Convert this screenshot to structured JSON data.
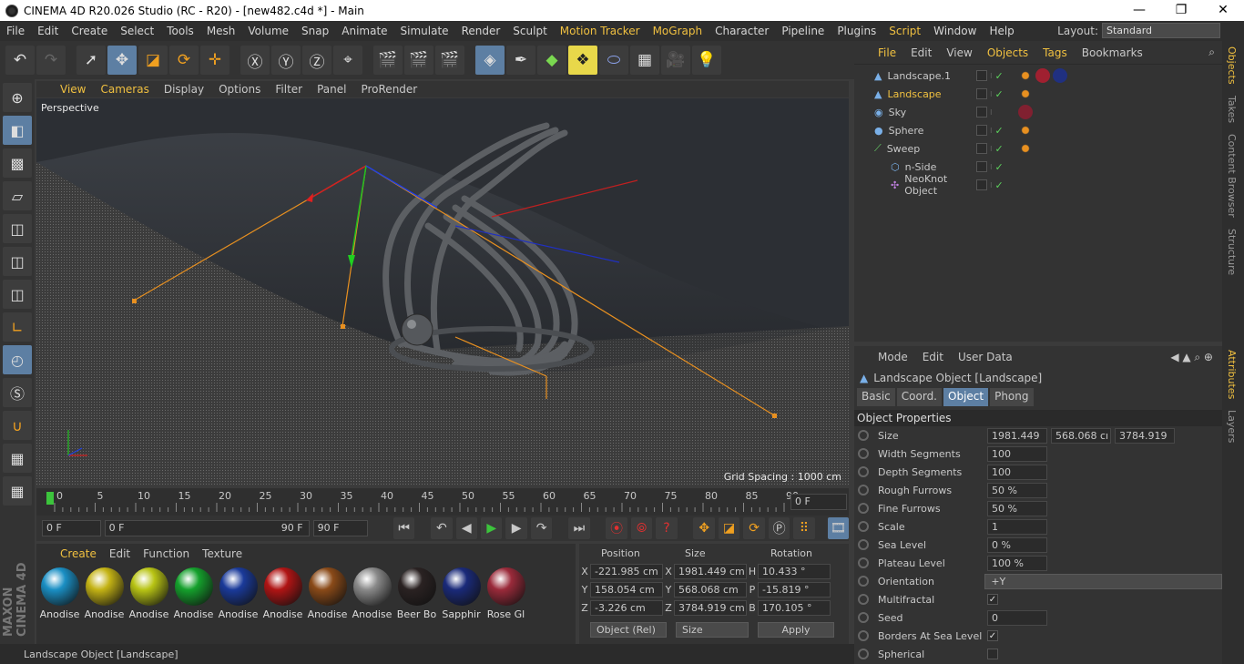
{
  "window": {
    "title": "CINEMA 4D R20.026 Studio (RC - R20) - [new482.c4d *] - Main",
    "minimize": "—",
    "maximize": "❐",
    "close": "✕"
  },
  "menubar": {
    "items": [
      "File",
      "Edit",
      "Create",
      "Select",
      "Tools",
      "Mesh",
      "Volume",
      "Snap",
      "Animate",
      "Simulate",
      "Render",
      "Sculpt",
      "Motion Tracker",
      "MoGraph",
      "Character",
      "Pipeline",
      "Plugins",
      "Script",
      "Window",
      "Help"
    ],
    "layout_label": "Layout:",
    "layout_value": "Standard"
  },
  "viewport": {
    "menu": [
      "View",
      "Cameras",
      "Display",
      "Options",
      "Filter",
      "Panel",
      "ProRender"
    ],
    "label": "Perspective",
    "grid_spacing": "Grid Spacing : 1000 cm"
  },
  "timeline": {
    "ticks": [
      "0",
      "5",
      "10",
      "15",
      "20",
      "25",
      "30",
      "35",
      "40",
      "45",
      "50",
      "55",
      "60",
      "65",
      "70",
      "75",
      "80",
      "85",
      "90"
    ],
    "current_frame": "0 F",
    "start": "0 F",
    "range_start": "0 F",
    "range_end": "90 F",
    "end": "90 F"
  },
  "materials": {
    "menu": [
      "Create",
      "Edit",
      "Function",
      "Texture"
    ],
    "items": [
      {
        "label": "Anodise",
        "color": "#1a8fc4"
      },
      {
        "label": "Anodise",
        "color": "#c4b314"
      },
      {
        "label": "Anodise",
        "color": "#b8c414"
      },
      {
        "label": "Anodise",
        "color": "#14a02c"
      },
      {
        "label": "Anodise",
        "color": "#1a3a9a"
      },
      {
        "label": "Anodise",
        "color": "#b01414"
      },
      {
        "label": "Anodise",
        "color": "#8a4a18"
      },
      {
        "label": "Anodise",
        "color": "#8a8a8a"
      },
      {
        "label": "Beer Bo",
        "color": "#2a2222"
      },
      {
        "label": "Sapphir",
        "color": "#1a2a7a"
      },
      {
        "label": "Rose Gl",
        "color": "#9a2a3a"
      }
    ]
  },
  "coords": {
    "headers": [
      "Position",
      "Size",
      "Rotation"
    ],
    "rows": [
      {
        "axis": "X",
        "pos": "-221.985 cm",
        "size_axis": "X",
        "size": "1981.449 cm",
        "rot_axis": "H",
        "rot": "10.433 °"
      },
      {
        "axis": "Y",
        "pos": "158.054 cm",
        "size_axis": "Y",
        "size": "568.068 cm",
        "rot_axis": "P",
        "rot": "-15.819 °"
      },
      {
        "axis": "Z",
        "pos": "-3.226 cm",
        "size_axis": "Z",
        "size": "3784.919 cm",
        "rot_axis": "B",
        "rot": "170.105 °"
      }
    ],
    "mode": "Object (Rel)",
    "size_mode": "Size",
    "apply": "Apply"
  },
  "status": "Landscape Object [Landscape]",
  "objects": {
    "menu": [
      "File",
      "Edit",
      "View",
      "Objects",
      "Tags",
      "Bookmarks"
    ],
    "rows": [
      {
        "name": "Landscape.1",
        "icon": "landscape-icon"
      },
      {
        "name": "Landscape",
        "icon": "landscape-icon"
      },
      {
        "name": "Sky",
        "icon": "sky-icon"
      },
      {
        "name": "Sphere",
        "icon": "sphere-icon"
      },
      {
        "name": "Sweep",
        "icon": "sweep-icon"
      },
      {
        "name": "n-Side",
        "icon": "nside-icon"
      },
      {
        "name": "NeoKnot Object",
        "icon": "knot-icon"
      }
    ]
  },
  "attributes": {
    "menu": [
      "Mode",
      "Edit",
      "User Data"
    ],
    "title": "Landscape Object [Landscape]",
    "tabs": [
      "Basic",
      "Coord.",
      "Object",
      "Phong"
    ],
    "section": "Object Properties",
    "size_label": "Size",
    "size": [
      "1981.449",
      "568.068 cı",
      "3784.919"
    ],
    "width_segments_label": "Width Segments",
    "width_segments": "100",
    "depth_segments_label": "Depth Segments",
    "depth_segments": "100",
    "rough_furrows_label": "Rough Furrows",
    "rough_furrows": "50 %",
    "fine_furrows_label": "Fine Furrows",
    "fine_furrows": "50 %",
    "scale_label": "Scale",
    "scale": "1",
    "sea_level_label": "Sea Level",
    "sea_level": "0 %",
    "plateau_level_label": "Plateau Level",
    "plateau_level": "100 %",
    "orientation_label": "Orientation",
    "orientation": "+Y",
    "multifractal_label": "Multifractal",
    "seed_label": "Seed",
    "seed": "0",
    "borders_label": "Borders At Sea Level",
    "spherical_label": "Spherical"
  },
  "side_tabs": [
    "Objects",
    "Takes",
    "Content Browser",
    "Structure",
    "Attributes",
    "Layers"
  ]
}
